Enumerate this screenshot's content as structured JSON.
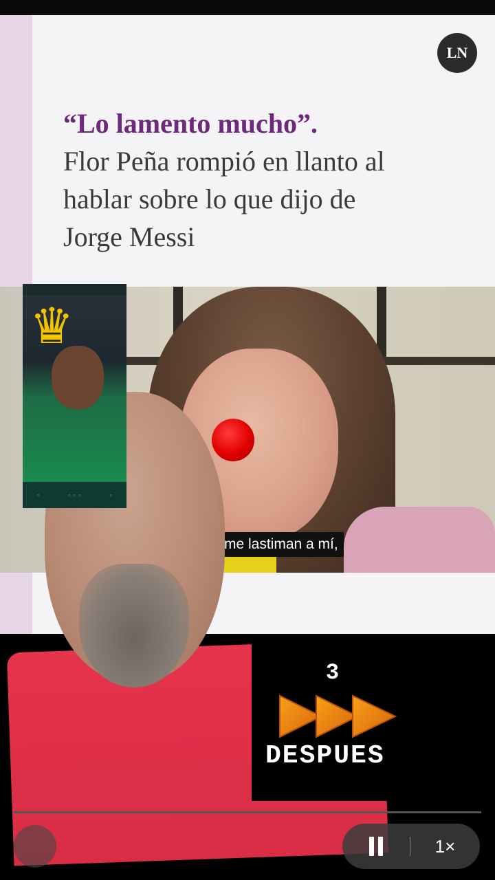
{
  "article": {
    "logo_text": "LN",
    "headline_quote": "“Lo lamento mucho”.",
    "headline_body": "Flor Peña rompió en llanto al hablar sobre lo que dijo de Jorge Messi",
    "accent_color": "#6c2a7b"
  },
  "video": {
    "subtitle": "me lastiman a mí,"
  },
  "overlay": {
    "skip_count": "3",
    "skip_label": "DESPUES"
  },
  "player": {
    "progress": 0.0,
    "speed_label": "1×"
  },
  "icons": {
    "pause": "pause-icon",
    "crown": "crown-icon",
    "clown_nose": "clown-nose-sticker",
    "fast_forward": "fast-forward-icon"
  }
}
